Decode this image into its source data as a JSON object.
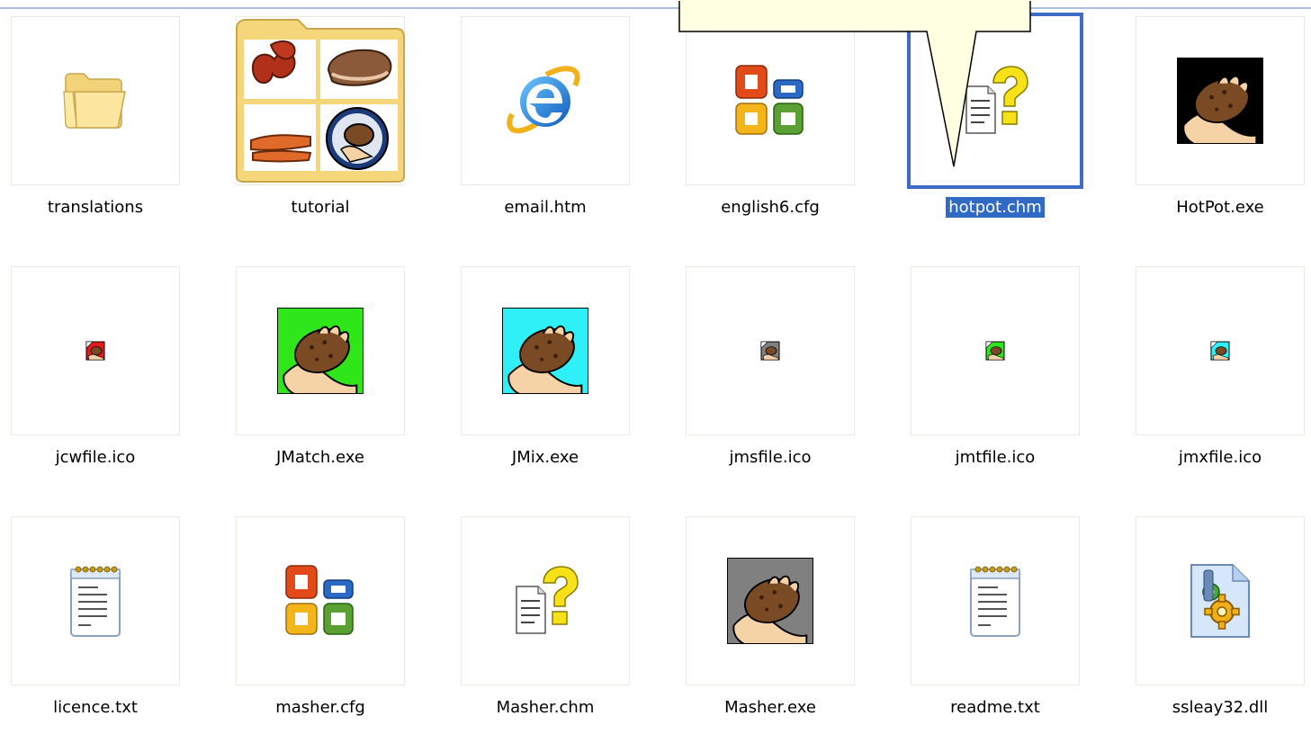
{
  "files": [
    {
      "name": "translations",
      "icon": "folder-icon"
    },
    {
      "name": "tutorial",
      "icon": "tutorial-folder-thumbnail-icon"
    },
    {
      "name": "email.htm",
      "icon": "internet-explorer-icon"
    },
    {
      "name": "english6.cfg",
      "icon": "office-cfg-icon"
    },
    {
      "name": "hotpot.chm",
      "icon": "help-file-icon",
      "selected": true
    },
    {
      "name": "HotPot.exe",
      "icon": "hotpot-potato-black-icon"
    },
    {
      "name": "jcwfile.ico",
      "icon": "small-potato-red-icon"
    },
    {
      "name": "JMatch.exe",
      "icon": "potato-green-icon"
    },
    {
      "name": "JMix.exe",
      "icon": "potato-cyan-icon"
    },
    {
      "name": "jmsfile.ico",
      "icon": "small-potato-gray-icon"
    },
    {
      "name": "jmtfile.ico",
      "icon": "small-potato-green-icon"
    },
    {
      "name": "jmxfile.ico",
      "icon": "small-potato-cyan-icon"
    },
    {
      "name": "licence.txt",
      "icon": "notepad-icon"
    },
    {
      "name": "masher.cfg",
      "icon": "office-cfg-icon"
    },
    {
      "name": "Masher.chm",
      "icon": "help-file-icon"
    },
    {
      "name": "Masher.exe",
      "icon": "potato-gray-icon"
    },
    {
      "name": "readme.txt",
      "icon": "notepad-icon"
    },
    {
      "name": "ssleay32.dll",
      "icon": "dll-gear-icon"
    }
  ],
  "colors": {
    "selection": "#316ac5",
    "selection_border": "#3c6cc4",
    "thumb_border": "#ebe9e0"
  }
}
